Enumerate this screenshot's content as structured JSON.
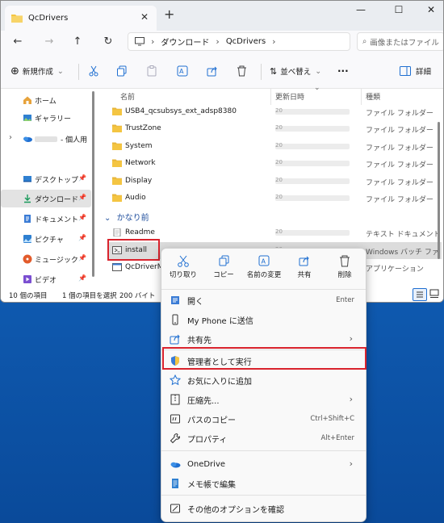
{
  "window": {
    "tab_title": "QcDrivers",
    "new_tab": "+",
    "controls": [
      "—",
      "☐",
      "✕"
    ]
  },
  "address": {
    "crumbs": [
      "ダウンロード",
      "QcDrivers"
    ],
    "search_placeholder": "画像またはファイル"
  },
  "toolbar": {
    "new_label": "新規作成",
    "sort_label": "並べ替え",
    "more_label": "···",
    "details_label": "詳細"
  },
  "nav": {
    "items": [
      {
        "label": "ホーム",
        "icon": "home-icon"
      },
      {
        "label": "ギャラリー",
        "icon": "gallery-icon"
      },
      {
        "label": "- 個人用",
        "icon": "onedrive-icon"
      },
      {
        "label": "デスクトップ",
        "icon": "desktop-icon"
      },
      {
        "label": "ダウンロード",
        "icon": "download-icon"
      },
      {
        "label": "ドキュメント",
        "icon": "documents-icon"
      },
      {
        "label": "ピクチャ",
        "icon": "pictures-icon"
      },
      {
        "label": "ミュージック",
        "icon": "music-icon"
      },
      {
        "label": "ビデオ",
        "icon": "video-icon"
      }
    ]
  },
  "columns": {
    "name": "名前",
    "date": "更新日時",
    "type": "種類"
  },
  "groups": {
    "earlier": "かなり前"
  },
  "folders": [
    {
      "name": "USB4_qcsubsys_ext_adsp8380",
      "type": "ファイル フォルダー",
      "date": "20"
    },
    {
      "name": "TrustZone",
      "type": "ファイル フォルダー",
      "date": "20"
    },
    {
      "name": "System",
      "type": "ファイル フォルダー",
      "date": "20"
    },
    {
      "name": "Network",
      "type": "ファイル フォルダー",
      "date": "20"
    },
    {
      "name": "Display",
      "type": "ファイル フォルダー",
      "date": "20"
    },
    {
      "name": "Audio",
      "type": "ファイル フォルダー",
      "date": "20"
    }
  ],
  "files": [
    {
      "name": "Readme",
      "type": "テキスト ドキュメント",
      "date": "20"
    },
    {
      "name": "install",
      "type": "Windows バッチ ファ",
      "date": "20"
    },
    {
      "name": "QcDriverMi",
      "type": "アプリケーション",
      "date": "20"
    }
  ],
  "status": {
    "count": "10 個の項目",
    "selection": "1 個の項目を選択",
    "size": "200 バイト"
  },
  "context_menu": {
    "quick_actions": [
      {
        "label": "切り取り",
        "icon": "scissors-icon"
      },
      {
        "label": "コピー",
        "icon": "copy-icon"
      },
      {
        "label": "名前の変更",
        "icon": "rename-icon"
      },
      {
        "label": "共有",
        "icon": "share-icon"
      },
      {
        "label": "削除",
        "icon": "trash-icon"
      }
    ],
    "items": [
      {
        "label": "開く",
        "shortcut": "Enter",
        "icon": "open-icon"
      },
      {
        "label": "My Phone に送信",
        "icon": "phone-icon"
      },
      {
        "label": "共有先",
        "icon": "share-to-icon",
        "arrow": "›"
      },
      {
        "label": "管理者として実行",
        "icon": "shield-icon"
      },
      {
        "label": "お気に入りに追加",
        "icon": "star-icon"
      },
      {
        "label": "圧縮先...",
        "icon": "zip-icon",
        "arrow": "›"
      },
      {
        "label": "パスのコピー",
        "shortcut": "Ctrl+Shift+C",
        "icon": "copy-path-icon"
      },
      {
        "label": "プロパティ",
        "shortcut": "Alt+Enter",
        "icon": "wrench-icon"
      },
      {
        "label": "OneDrive",
        "icon": "onedrive-icon",
        "arrow": "›"
      },
      {
        "label": "メモ帳で編集",
        "icon": "notepad-icon"
      },
      {
        "label": "その他のオプションを確認",
        "icon": "more-options-icon"
      }
    ]
  },
  "colors": {
    "accent": "#1f6fd1",
    "highlight": "#d9232d",
    "folder": "#f4c542",
    "desktop_bg": "#1565c0"
  }
}
